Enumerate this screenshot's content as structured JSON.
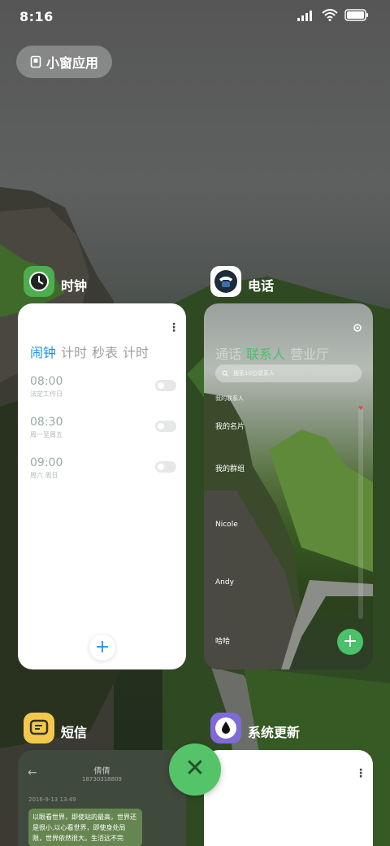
{
  "status_bar": {
    "time": "8:16"
  },
  "small_window": {
    "label": "小窗应用"
  },
  "apps": {
    "clock": {
      "name": "时钟",
      "tabs": [
        "闹钟",
        "计时",
        "秒表",
        "计时"
      ],
      "alarms": [
        {
          "time": "08:00",
          "repeat": "法定工作日"
        },
        {
          "time": "08:30",
          "repeat": "周一至周五"
        },
        {
          "time": "09:00",
          "repeat": "周六 周日"
        }
      ],
      "add": "+"
    },
    "phone": {
      "name": "电话",
      "tabs": [
        "通话",
        "联系人",
        "营业厅"
      ],
      "search_placeholder": "搜索10位联系人",
      "section": "我的联系人",
      "contacts": [
        "我的名片",
        "我的群组",
        "Nicole",
        "Andy",
        "哈哈"
      ],
      "add": "+"
    },
    "sms": {
      "name": "短信",
      "contact": "倩倩",
      "number": "18730318809",
      "date": "2016-9-13 13:49",
      "message": "以眼看世界，即使站的最高，世界还是很小,以心看世界，即使身处局限，世界依然很大。生活远不完"
    },
    "update": {
      "name": "系统更新"
    }
  },
  "colors": {
    "accent_blue": "#1f8ef1",
    "accent_green": "#4cc06a",
    "clock_icon": "#4cae4f",
    "sms_icon": "#f4c84a",
    "update_icon": "#7e6bd8"
  }
}
